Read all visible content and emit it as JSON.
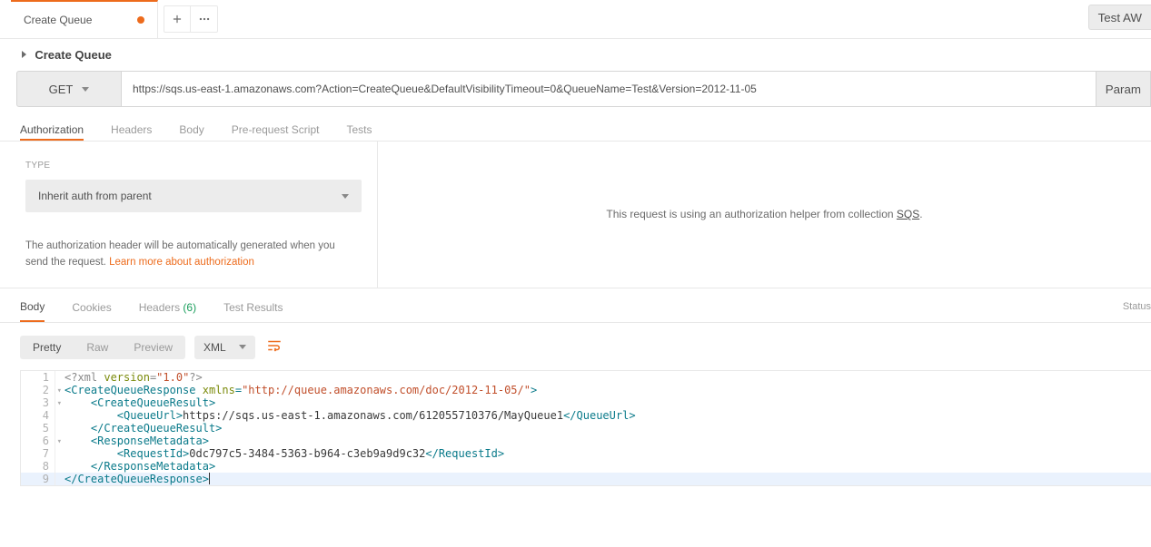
{
  "top": {
    "tab_title": "Create Queue",
    "test_btn": "Test AW"
  },
  "title": "Create Queue",
  "request": {
    "method": "GET",
    "url": "https://sqs.us-east-1.amazonaws.com?Action=CreateQueue&DefaultVisibilityTimeout=0&QueueName=Test&Version=2012-11-05",
    "params_btn": "Param"
  },
  "tabs": {
    "auth": "Authorization",
    "headers": "Headers",
    "body": "Body",
    "prereq": "Pre-request Script",
    "tests": "Tests"
  },
  "auth": {
    "type_label": "TYPE",
    "type_value": "Inherit auth from parent",
    "help_text": "The authorization header will be automatically generated when you send the request. ",
    "help_link": "Learn more about authorization",
    "right_text_pre": "This request is using an authorization helper from collection ",
    "right_link": "SQS",
    "right_text_post": "."
  },
  "resp_tabs": {
    "body": "Body",
    "cookies": "Cookies",
    "headers": "Headers",
    "headers_count": "(6)",
    "tests": "Test Results",
    "status": "Status"
  },
  "format": {
    "pretty": "Pretty",
    "raw": "Raw",
    "preview": "Preview",
    "lang": "XML"
  },
  "code_lines": [
    {
      "n": "1",
      "fold": "",
      "indent": 0,
      "parts": [
        {
          "t": "pi",
          "v": "<?xml "
        },
        {
          "t": "attr-name",
          "v": "version"
        },
        {
          "t": "pi",
          "v": "="
        },
        {
          "t": "attr-val",
          "v": "\"1.0\""
        },
        {
          "t": "pi",
          "v": "?>"
        }
      ]
    },
    {
      "n": "2",
      "fold": "▾",
      "indent": 0,
      "parts": [
        {
          "t": "tag",
          "v": "<CreateQueueResponse "
        },
        {
          "t": "attr-name",
          "v": "xmlns"
        },
        {
          "t": "tag",
          "v": "="
        },
        {
          "t": "attr-val",
          "v": "\"http://queue.amazonaws.com/doc/2012-11-05/\""
        },
        {
          "t": "tag",
          "v": ">"
        }
      ]
    },
    {
      "n": "3",
      "fold": "▾",
      "indent": 1,
      "parts": [
        {
          "t": "tag",
          "v": "<CreateQueueResult>"
        }
      ]
    },
    {
      "n": "4",
      "fold": "",
      "indent": 2,
      "parts": [
        {
          "t": "tag",
          "v": "<QueueUrl>"
        },
        {
          "t": "txt",
          "v": "https://sqs.us-east-1.amazonaws.com/612055710376/MayQueue1"
        },
        {
          "t": "tag",
          "v": "</QueueUrl>"
        }
      ]
    },
    {
      "n": "5",
      "fold": "",
      "indent": 1,
      "parts": [
        {
          "t": "tag",
          "v": "</CreateQueueResult>"
        }
      ]
    },
    {
      "n": "6",
      "fold": "▾",
      "indent": 1,
      "parts": [
        {
          "t": "tag",
          "v": "<ResponseMetadata>"
        }
      ]
    },
    {
      "n": "7",
      "fold": "",
      "indent": 2,
      "parts": [
        {
          "t": "tag",
          "v": "<RequestId>"
        },
        {
          "t": "txt",
          "v": "0dc797c5-3484-5363-b964-c3eb9a9d9c32"
        },
        {
          "t": "tag",
          "v": "</RequestId>"
        }
      ]
    },
    {
      "n": "8",
      "fold": "",
      "indent": 1,
      "parts": [
        {
          "t": "tag",
          "v": "</ResponseMetadata>"
        }
      ]
    },
    {
      "n": "9",
      "fold": "",
      "indent": 0,
      "cursor": true,
      "parts": [
        {
          "t": "tag",
          "v": "</CreateQueueResponse>"
        }
      ]
    }
  ]
}
